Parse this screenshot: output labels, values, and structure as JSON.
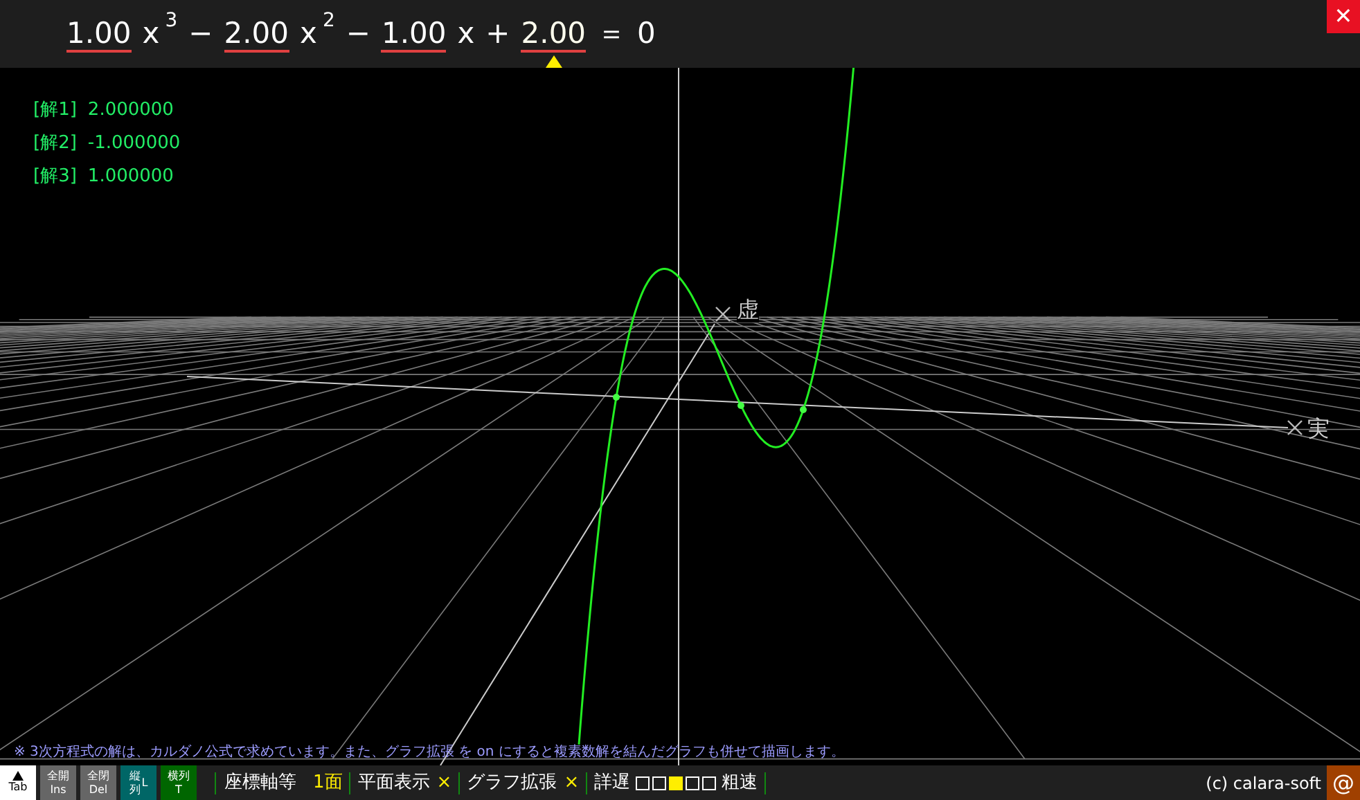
{
  "equation": {
    "terms": [
      {
        "coef": "1.00",
        "variable": "x",
        "power": "3",
        "selected": false
      },
      {
        "sign": "−",
        "coef": "2.00",
        "variable": "x",
        "power": "2",
        "selected": false
      },
      {
        "sign": "−",
        "coef": "1.00",
        "variable": "x",
        "selected": false
      },
      {
        "sign": "+",
        "coef": "2.00",
        "selected": true
      }
    ],
    "equals": "＝",
    "rhs": "0"
  },
  "close_button": "✕",
  "solutions": [
    {
      "label": "[解1]",
      "value": "2.000000"
    },
    {
      "label": "[解2]",
      "value": "-1.000000"
    },
    {
      "label": "[解3]",
      "value": "1.000000"
    }
  ],
  "axes": {
    "imaginary_label": "虚",
    "real_label": "実"
  },
  "note": "※ 3次方程式の解は、カルダノ公式で求めています。また、グラフ拡張 を on にすると複素数解を結んだグラフも併せて描画します。",
  "toolbar": {
    "buttons": [
      {
        "kind": "tab",
        "line2": "Tab",
        "color": "#ffffff"
      },
      {
        "kind": "text",
        "line1": "全開",
        "line2": "Ins",
        "color": "#666666"
      },
      {
        "kind": "text",
        "line1": "全閉",
        "line2": "Del",
        "color": "#666666"
      },
      {
        "kind": "text",
        "line1": "縦",
        "line2": "列",
        "side": "L",
        "color": "#006666"
      },
      {
        "kind": "text",
        "line1": "横列",
        "line2": "T",
        "color": "#006600"
      }
    ],
    "axes_label": "座標軸等",
    "face_count": "1面",
    "toggles": [
      {
        "label": "平面表示",
        "value": "×"
      },
      {
        "label": "グラフ拡張",
        "value": "×"
      }
    ],
    "slow_label": "詳遅",
    "speed": [
      {
        "selected": false
      },
      {
        "selected": false
      },
      {
        "selected": true
      },
      {
        "selected": false
      },
      {
        "selected": false
      }
    ],
    "fast_label": "粗速"
  },
  "copyright": "(c) calara-soft",
  "at_button": "@"
}
